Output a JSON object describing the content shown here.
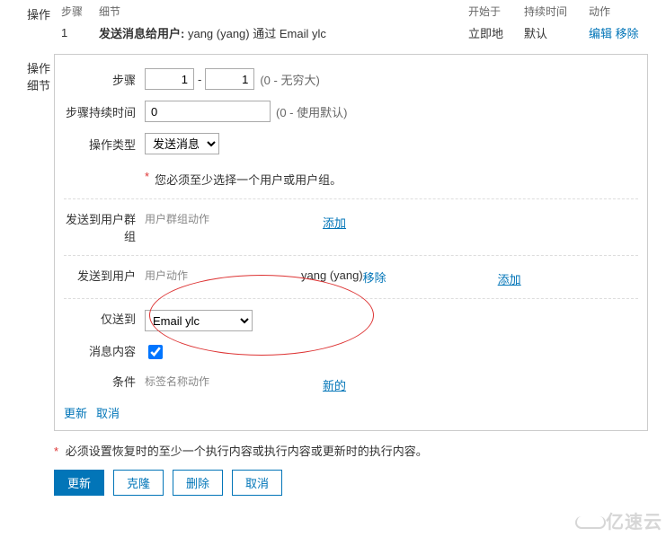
{
  "operations": {
    "section_label": "操作",
    "headers": {
      "step": "步骤",
      "detail": "细节",
      "start_at": "开始于",
      "duration": "持续时间",
      "action": "动作"
    },
    "rows": [
      {
        "step": "1",
        "detail_bold": "发送消息给用户:",
        "detail_rest": "yang (yang) 通过 Email ylc",
        "start_at": "立即地",
        "duration": "默认",
        "edit": "编辑",
        "remove": "移除"
      }
    ]
  },
  "details": {
    "section_label": "操作细节",
    "step": {
      "label": "步骤",
      "from": "1",
      "to": "1",
      "range_hint": "(0 - 无穷大)"
    },
    "step_duration": {
      "label": "步骤持续时间",
      "value": "0",
      "hint": "(0 - 使用默认)"
    },
    "op_type": {
      "label": "操作类型",
      "value": "发送消息"
    },
    "validation": {
      "required_mark": "*",
      "text": "您必须至少选择一个用户或用户组。"
    },
    "send_to_groups": {
      "label": "发送到用户群组",
      "col_user_group": "用户群组",
      "col_action": "动作",
      "add": "添加"
    },
    "send_to_users": {
      "label": "发送到用户",
      "col_user": "用户",
      "col_action": "动作",
      "items": [
        {
          "name": "yang (yang)",
          "remove": "移除"
        }
      ],
      "add": "添加"
    },
    "send_only_to": {
      "label": "仅送到",
      "value": "Email ylc"
    },
    "message_content": {
      "label": "消息内容",
      "checked": true
    },
    "condition": {
      "label": "条件",
      "col_tag": "标签",
      "col_name": "名称",
      "col_action": "动作",
      "new": "新的"
    },
    "panel_actions": {
      "update": "更新",
      "cancel": "取消"
    }
  },
  "bottom": {
    "required_mark": "*",
    "warning": "必须设置恢复时的至少一个执行内容或执行内容或更新时的执行内容。",
    "buttons": {
      "update": "更新",
      "clone": "克隆",
      "delete": "删除",
      "cancel": "取消"
    }
  },
  "watermark": "亿速云"
}
